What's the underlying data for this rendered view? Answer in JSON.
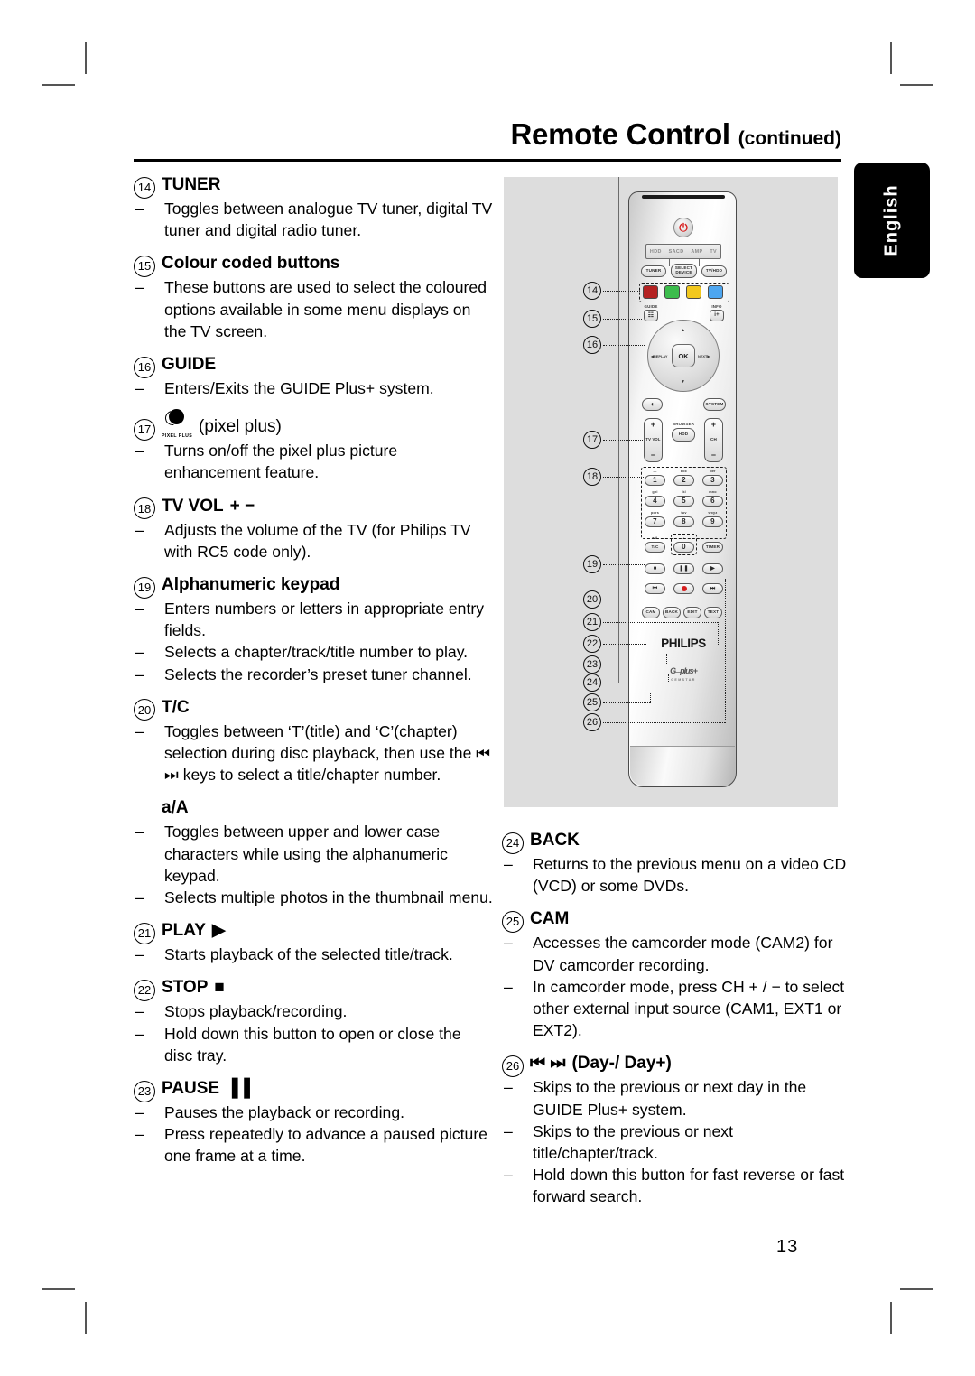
{
  "header": {
    "title": "Remote Control",
    "continued": "(continued)"
  },
  "language_tab": "English",
  "page_number": "13",
  "left_column": [
    {
      "num": "14",
      "heading": "TUNER",
      "bullets": [
        "Toggles between analogue TV tuner, digital TV tuner and digital radio tuner."
      ]
    },
    {
      "num": "15",
      "heading": "Colour coded buttons",
      "bullets": [
        "These buttons are used to select the coloured options available in some menu displays on the TV screen."
      ]
    },
    {
      "num": "16",
      "heading": "GUIDE",
      "bullets": [
        "Enters/Exits the GUIDE Plus+ system."
      ]
    },
    {
      "num": "17",
      "heading": "(pixel plus)",
      "icon": "pixel-plus-icon",
      "bullets": [
        "Turns on/off the pixel plus picture enhancement feature."
      ]
    },
    {
      "num": "18",
      "heading": "TV  VOL",
      "heading_symbols": "+ −",
      "bullets": [
        "Adjusts the volume of the TV (for Philips TV with RC5 code only)."
      ]
    },
    {
      "num": "19",
      "heading": "Alphanumeric keypad",
      "bullets": [
        "Enters numbers or letters in appropriate entry fields.",
        "Selects a chapter/track/title number to play.",
        "Selects the recorder’s preset tuner channel."
      ]
    },
    {
      "num": "20",
      "heading": "T/C",
      "bullets": [
        "Toggles between ‘T’(title) and ‘C’(chapter) selection during disc playback, then use the ⏮ ⏭ keys to select a title/chapter number."
      ]
    },
    {
      "num": "",
      "heading": "a/A",
      "bullets": [
        "Toggles between upper and lower case characters while using the alphanumeric keypad.",
        "Selects multiple photos in the thumbnail menu."
      ]
    },
    {
      "num": "21",
      "heading": "PLAY",
      "heading_symbols": "▶",
      "bullets": [
        "Starts playback of the selected title/track."
      ]
    },
    {
      "num": "22",
      "heading": "STOP",
      "heading_symbols": "■",
      "bullets": [
        "Stops playback/recording.",
        "Hold down this button to open or close the disc tray."
      ]
    },
    {
      "num": "23",
      "heading": "PAUSE",
      "heading_symbols": "▐▐",
      "bullets": [
        "Pauses the playback or recording.",
        "Press repeatedly to advance a paused picture one frame at a time."
      ]
    }
  ],
  "right_column": [
    {
      "num": "24",
      "heading": "BACK",
      "bullets": [
        "Returns to the previous menu on a video CD (VCD) or some DVDs."
      ]
    },
    {
      "num": "25",
      "heading": "CAM",
      "bullets": [
        "Accesses the camcorder mode (CAM2) for DV camcorder recording.",
        "In camcorder mode, press CH + / − to select other external input source (CAM1, EXT1 or EXT2)."
      ]
    },
    {
      "num": "26",
      "heading": "(Day-/ Day+)",
      "heading_symbols": "⏮ ⏭",
      "bullets": [
        "Skips to the previous or next day in the GUIDE Plus+ system.",
        "Skips to the previous or next title/chapter/track.",
        "Hold down this button for fast reverse or fast forward search."
      ]
    }
  ],
  "figure": {
    "brand": "PHILIPS",
    "sub_brand": "GUIDE Plus+",
    "sub_brand_tag": "GEMSTAR",
    "mode_display": [
      "HDD",
      "SACD",
      "AMP",
      "TV"
    ],
    "power_icon": "power-icon",
    "power_color": "#d61f1f",
    "colour_buttons": [
      {
        "name": "red-button",
        "color": "#b42222"
      },
      {
        "name": "green-button",
        "color": "#3cbc4c"
      },
      {
        "name": "yellow-button",
        "color": "#f2c81e"
      },
      {
        "name": "blue-button",
        "color": "#4da6f0"
      }
    ],
    "keys": {
      "tuner": "TUNER",
      "select_device": "SELECT DEVICE",
      "tv_hdd": "TV/HDD",
      "guide_label": "GUIDE",
      "info_label": "INFO",
      "ok": "OK",
      "replay": "REPLAY",
      "next": "NEXT",
      "system": "SYSTEM",
      "browser_label": "BROWSER",
      "hdd": "HDD",
      "tv_vol_label": "TV VOL",
      "ch_label": "CH",
      "plus": "+",
      "minus": "−",
      "timer": "TIMER",
      "tc": "T/C",
      "tc_label": "a/A",
      "zero_label": ".",
      "cam": "CAM",
      "back": "BACK",
      "edit": "EDIT",
      "text": "TEXT"
    },
    "keypad": [
      {
        "digit": "1",
        "letters": "—"
      },
      {
        "digit": "2",
        "letters": "abc"
      },
      {
        "digit": "3",
        "letters": "def"
      },
      {
        "digit": "4",
        "letters": "ghi"
      },
      {
        "digit": "5",
        "letters": "jkl"
      },
      {
        "digit": "6",
        "letters": "mno"
      },
      {
        "digit": "7",
        "letters": "pqrs"
      },
      {
        "digit": "8",
        "letters": "tuv"
      },
      {
        "digit": "9",
        "letters": "wxyz"
      },
      {
        "digit": "0",
        "letters": "."
      }
    ],
    "callouts": [
      "14",
      "15",
      "16",
      "17",
      "18",
      "19",
      "20",
      "21",
      "22",
      "23",
      "24",
      "25",
      "26"
    ]
  }
}
